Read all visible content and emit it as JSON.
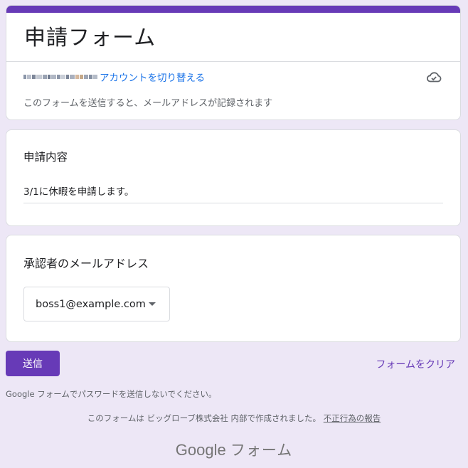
{
  "header": {
    "title": "申請フォーム",
    "switch_account": "アカウントを切り替える",
    "notice": "このフォームを送信すると、メールアドレスが記録されます"
  },
  "questions": [
    {
      "title": "申請内容",
      "answer": "3/1に休暇を申請します。"
    },
    {
      "title": "承認者のメールアドレス",
      "selected": "boss1@example.com"
    }
  ],
  "actions": {
    "submit": "送信",
    "clear": "フォームをクリア"
  },
  "footer": {
    "password_warning": "Google フォームでパスワードを送信しないでください。",
    "created_by": "このフォームは ビッグローブ株式会社 内部で作成されました。",
    "report_abuse": "不正行為の報告",
    "logo_google": "Google",
    "logo_forms": "フォーム"
  },
  "icons": {
    "cloud": "cloud-saved-icon",
    "dropdown": "dropdown-arrow-icon"
  },
  "colors": {
    "accent": "#673ab7",
    "background": "#ede7f6",
    "link": "#1a73e8"
  }
}
